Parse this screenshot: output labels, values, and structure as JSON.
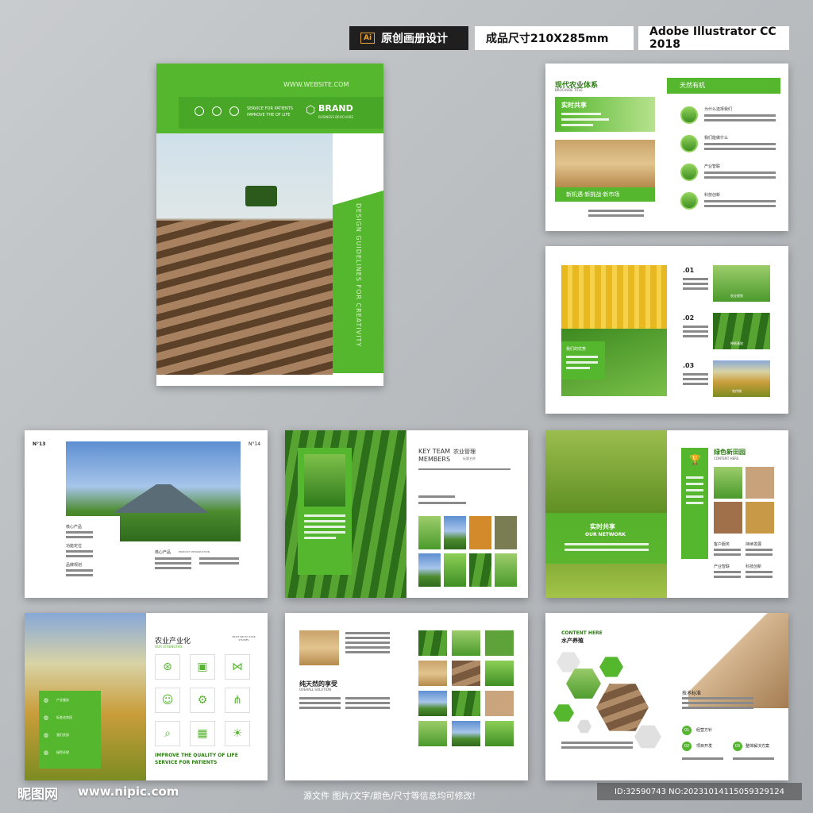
{
  "header": {
    "tag1_icon": "Ai",
    "tag1": "原创画册设计",
    "tag2": "成品尺寸210X285mm",
    "tag3": "Adobe Illustrator CC 2018"
  },
  "cover": {
    "website": "WWW.WEBSITE.COM",
    "service": "SERVICE FOR PATIENTS",
    "improve": "IMPROVE THE OF LIFE",
    "brand": "BRAND",
    "brand_sub": "BUSINESS BROCHURE",
    "vertical": "DESIGN GUIDELINES FOR CREATIVITY"
  },
  "spread1": {
    "title": "现代农业体系",
    "title_en": "BROCHURE TITLE",
    "share": "实时共享",
    "bottom": "新机遇·新挑战·新市场",
    "right_title": "天然有机",
    "items": [
      "为什么选择我们",
      "我们能做什么",
      "产业智联",
      "科技创新"
    ]
  },
  "spread2": {
    "badge": "我们的优势",
    "n1": ".01",
    "n2": ".02",
    "n3": ".03",
    "cap1": "农业规划",
    "cap2": "种植基地",
    "cap3": "农作物"
  },
  "spread3": {
    "no_left": "N°13",
    "no_right": "N°14",
    "l1": "核心产品",
    "l2": "功能定位",
    "l3": "品牌规划",
    "r1": "核心产品",
    "r1_en": "PRODUCT INTRODUCTION"
  },
  "spread4": {
    "key1": "KEY TEAM",
    "key2": "MEMBERS",
    "title": "农业管理",
    "sub": "标题名称"
  },
  "spread5": {
    "share": "实时共享",
    "share_en": "OUR NETWORK",
    "title": "绿色新田园",
    "title_en": "CONTENT HERE",
    "c1": "客户服务",
    "c2": "持续发展",
    "c3": "产业智联",
    "c4": "科技创新"
  },
  "spread6": {
    "title": "农业产业化",
    "title_en": "OUR STRENGTHS",
    "right_tag": "WHAT WE DO CASE STUDIES",
    "items": [
      "产业服务",
      "标准化农田",
      "我们优势",
      "绿色环保"
    ],
    "bottom1": "IMPROVE THE QUALITY OF LIFE",
    "bottom2": "SERVICE FOR PATIENTS"
  },
  "spread7": {
    "title": "纯天然的享受",
    "title_en": "OVERALL SOLUTION"
  },
  "spread8": {
    "title_en": "CONTENT HERE",
    "title": "水产养殖",
    "tech": "技术标准",
    "o1": "01",
    "o2": "02",
    "o3": "03",
    "t1": "经营方针",
    "t2": "项目开发",
    "t3": "整体解决方案"
  },
  "footer": {
    "logo": "昵图网",
    "url": "www.nipic.com",
    "note": "源文件 图片/文字/颜色/尺寸等信息均可修改!",
    "id": "ID:32590743 NO:20231014115059329124"
  }
}
